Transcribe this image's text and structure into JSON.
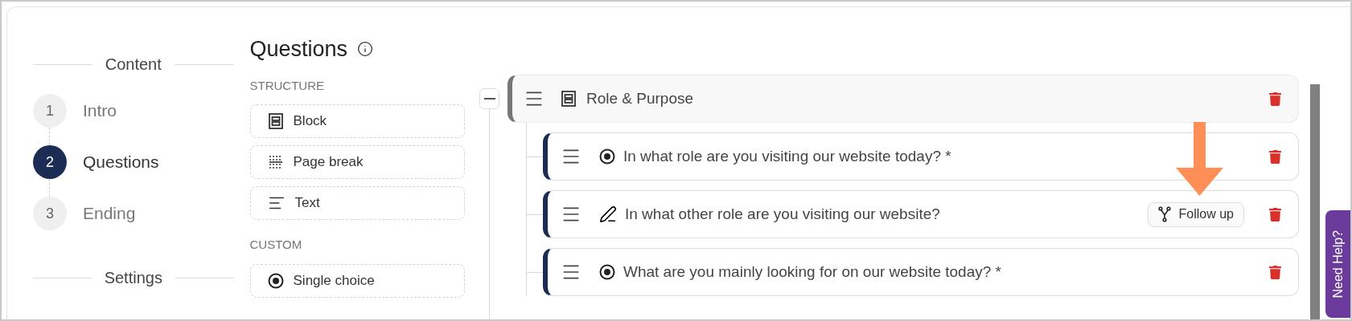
{
  "sidebar": {
    "sections": [
      {
        "title": "Content",
        "steps": [
          {
            "number": "1",
            "label": "Intro",
            "selected": false
          },
          {
            "number": "2",
            "label": "Questions",
            "selected": true
          },
          {
            "number": "3",
            "label": "Ending",
            "selected": false
          }
        ]
      },
      {
        "title": "Settings"
      }
    ]
  },
  "palette": {
    "title": "Questions",
    "groups": [
      {
        "heading": "STRUCTURE",
        "items": [
          {
            "kind": "block",
            "label": "Block"
          },
          {
            "kind": "page_break",
            "label": "Page break"
          },
          {
            "kind": "text",
            "label": "Text"
          }
        ]
      },
      {
        "heading": "CUSTOM",
        "items": [
          {
            "kind": "single_choice",
            "label": "Single choice"
          }
        ]
      }
    ]
  },
  "tree": {
    "block": {
      "title": "Role & Purpose",
      "expanded": true,
      "children": [
        {
          "kind": "single_choice",
          "text": "In what role are you visiting our website today? *"
        },
        {
          "kind": "open_text",
          "text": "In what other role are you visiting our website?",
          "follow_up": "Follow up"
        },
        {
          "kind": "single_choice",
          "text": "What are you mainly looking for on our website today? *"
        }
      ]
    }
  },
  "help_tab": "Need Help?"
}
